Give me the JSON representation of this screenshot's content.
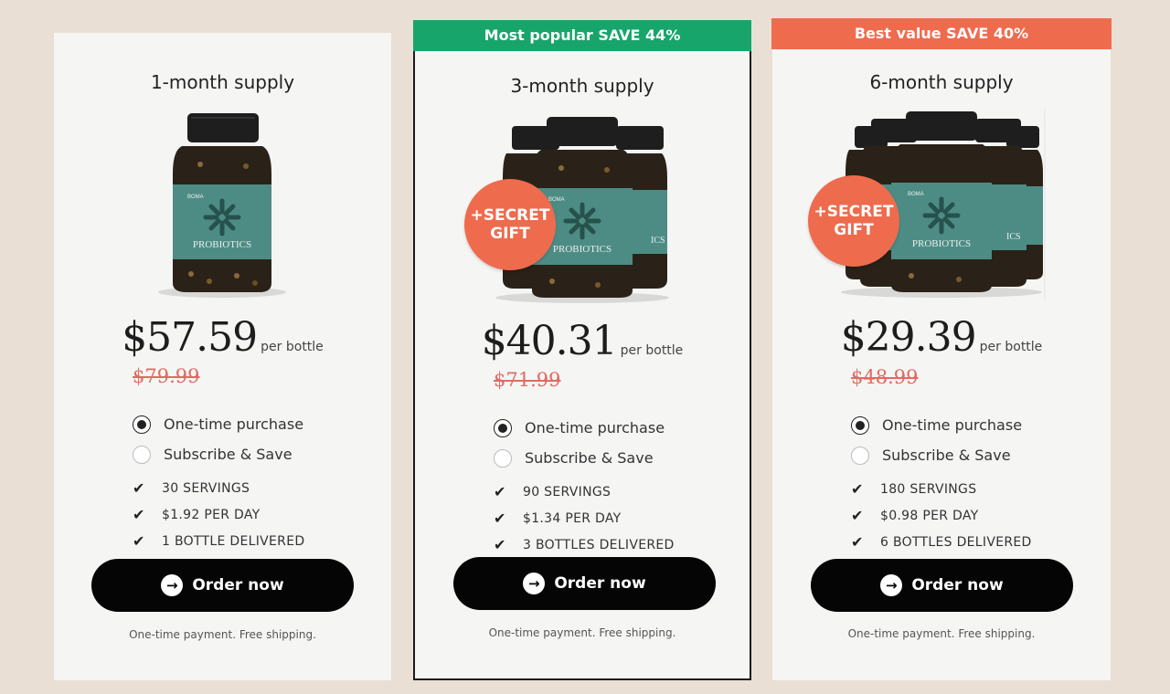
{
  "colors": {
    "background": "#e9dfd4",
    "card": "#f5f5f4",
    "popular_banner": "#18a56b",
    "best_value_banner": "#ef6b4e",
    "old_price": "#e06b62",
    "button": "#050505"
  },
  "plans": [
    {
      "banner": "",
      "title": "1-month supply",
      "price": "$57.59",
      "per": "per bottle",
      "old_price": "$79.99",
      "options": [
        "One-time purchase",
        "Subscribe & Save"
      ],
      "selected_option": "One-time purchase",
      "features": [
        "30 SERVINGS",
        "$1.92 PER DAY",
        "1 BOTTLE DELIVERED"
      ],
      "button": "Order now",
      "note": "One-time payment. Free shipping.",
      "bottles": 1
    },
    {
      "banner": "Most popular SAVE 44%",
      "title": "3-month supply",
      "gift": [
        "+SECRET",
        "GIFT"
      ],
      "price": "$40.31",
      "per": "per bottle",
      "old_price": "$71.99",
      "options": [
        "One-time purchase",
        "Subscribe & Save"
      ],
      "selected_option": "One-time purchase",
      "features": [
        "90 SERVINGS",
        "$1.34 PER DAY",
        "3 BOTTLES DELIVERED"
      ],
      "button": "Order now",
      "note": "One-time payment. Free shipping.",
      "bottles": 3
    },
    {
      "banner": "Best value SAVE 40%",
      "title": "6-month supply",
      "gift": [
        "+SECRET",
        "GIFT"
      ],
      "price": "$29.39",
      "per": "per bottle",
      "old_price": "$48.99",
      "options": [
        "One-time purchase",
        "Subscribe & Save"
      ],
      "selected_option": "One-time purchase",
      "features": [
        "180 SERVINGS",
        "$0.98 PER DAY",
        "6 BOTTLES DELIVERED"
      ],
      "button": "Order now",
      "note": "One-time payment. Free shipping.",
      "bottles": 6
    }
  ],
  "bottle_label": {
    "brand": "BOMA",
    "name": "PROBIOTICS"
  },
  "icons": {
    "arrow": "arrow-right-circle-icon",
    "check": "check-icon"
  }
}
